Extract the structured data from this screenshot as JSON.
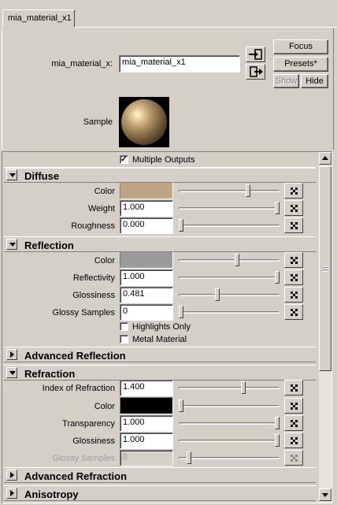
{
  "tab": {
    "label": "mia_material_x1"
  },
  "header": {
    "node_label": "mia_material_x:",
    "node_name": "mia_material_x1",
    "focus_label": "Focus",
    "presets_label": "Presets*",
    "show_label": "Show",
    "hide_label": "Hide",
    "sample_label": "Sample"
  },
  "multiple_outputs": {
    "label": "Multiple Outputs",
    "checked": true
  },
  "diffuse": {
    "title": "Diffuse",
    "color": {
      "label": "Color",
      "swatch": "#bfa583",
      "slider": 0.7
    },
    "weight": {
      "label": "Weight",
      "value": "1.000",
      "slider": 1.0
    },
    "roughness": {
      "label": "Roughness",
      "value": "0.000",
      "slider": 0.0
    }
  },
  "reflection": {
    "title": "Reflection",
    "color": {
      "label": "Color",
      "swatch": "#9b9b9b",
      "slider": 0.58
    },
    "reflectivity": {
      "label": "Reflectivity",
      "value": "1.000",
      "slider": 1.0
    },
    "glossiness": {
      "label": "Glossiness",
      "value": "0.481",
      "slider": 0.38
    },
    "glossy_samples": {
      "label": "Glossy Samples",
      "value": "0",
      "slider": 0.0
    },
    "highlights_only": {
      "label": "Highlights Only",
      "checked": false
    },
    "metal_material": {
      "label": "Metal Material",
      "checked": false
    }
  },
  "advanced_reflection": {
    "title": "Advanced Reflection"
  },
  "refraction": {
    "title": "Refraction",
    "ior": {
      "label": "Index of Refraction",
      "value": "1.400",
      "slider": 0.65
    },
    "color": {
      "label": "Color",
      "swatch": "#000000",
      "slider": 0.0
    },
    "transparency": {
      "label": "Transparency",
      "value": "1.000",
      "slider": 1.0
    },
    "glossiness": {
      "label": "Glossiness",
      "value": "1.000",
      "slider": 1.0
    },
    "glossy_samples": {
      "label": "Glossy Samples",
      "value": "8",
      "slider": 0.08,
      "disabled": true
    }
  },
  "advanced_refraction": {
    "title": "Advanced Refraction"
  },
  "anisotropy": {
    "title": "Anisotropy"
  }
}
